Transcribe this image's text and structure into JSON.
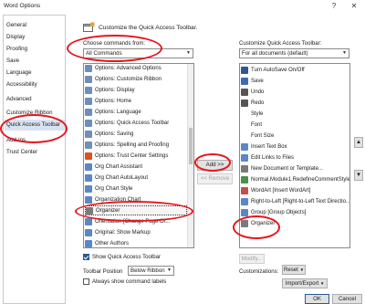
{
  "window": {
    "title": "Word Options",
    "help": "?",
    "close": "✕"
  },
  "sidebar": {
    "items": [
      {
        "label": "General"
      },
      {
        "label": "Display"
      },
      {
        "label": "Proofing"
      },
      {
        "label": "Save"
      },
      {
        "label": "Language"
      },
      {
        "label": "Accessibility"
      },
      {
        "label": "Advanced"
      },
      {
        "label": "Customize Ribbon"
      },
      {
        "label": "Quick Access Toolbar"
      },
      {
        "label": "Add-ins"
      },
      {
        "label": "Trust Center"
      }
    ],
    "active_index": 8
  },
  "header": {
    "title": "Customize the Quick Access Toolbar."
  },
  "left": {
    "choose_label": "Choose commands from:",
    "choose_value": "All Commands",
    "items": [
      {
        "label": "Options: Advanced Options",
        "icon": "options-icon",
        "color": "#6f8fb8"
      },
      {
        "label": "Options: Customize Ribbon",
        "icon": "options-icon",
        "color": "#6f8fb8"
      },
      {
        "label": "Options: Display",
        "icon": "options-icon",
        "color": "#6f8fb8"
      },
      {
        "label": "Options: Home",
        "icon": "options-icon",
        "color": "#6f8fb8"
      },
      {
        "label": "Options: Language",
        "icon": "options-icon",
        "color": "#6f8fb8"
      },
      {
        "label": "Options: Quick Access Toolbar",
        "icon": "options-icon",
        "color": "#6f8fb8"
      },
      {
        "label": "Options: Saving",
        "icon": "options-icon",
        "color": "#6f8fb8"
      },
      {
        "label": "Options: Spelling and Proofing",
        "icon": "options-icon",
        "color": "#6f8fb8"
      },
      {
        "label": "Options: Trust Center Settings",
        "icon": "shield-icon",
        "color": "#d9541e"
      },
      {
        "label": "Org Chart Assistant",
        "icon": "org-chart-icon",
        "color": "#5b87c7"
      },
      {
        "label": "Org Chart AutoLayout",
        "icon": "org-chart-icon",
        "color": "#5b87c7"
      },
      {
        "label": "Org Chart Style",
        "icon": "org-chart-icon",
        "color": "#5b87c7"
      },
      {
        "label": "Organization Chart",
        "icon": "org-chart-icon",
        "color": "#5b87c7"
      },
      {
        "label": "Organizer",
        "icon": "organizer-icon",
        "color": "#7a7a7a"
      },
      {
        "label": "Orientation [Change Page Or...",
        "icon": "orientation-icon",
        "color": "#5b87c7"
      },
      {
        "label": "Original: Show Markup",
        "icon": "markup-icon",
        "color": "#5b87c7"
      },
      {
        "label": "Other Authors",
        "icon": "authors-icon",
        "color": "#5b87c7"
      }
    ],
    "selected_index": 13
  },
  "middle": {
    "add_label": "Add >>",
    "remove_label": "<< Remove"
  },
  "right": {
    "customize_label": "Customize Quick Access Toolbar:",
    "customize_value": "For all documents (default)",
    "items": [
      {
        "label": "Turn AutoSave On/Off",
        "icon": "autosave-icon",
        "color": "#2b579a"
      },
      {
        "label": "Save",
        "icon": "save-icon",
        "color": "#3b6bb4"
      },
      {
        "label": "Undo",
        "icon": "undo-icon",
        "color": "#555555"
      },
      {
        "label": "Redo",
        "icon": "redo-icon",
        "color": "#555555"
      },
      {
        "label": "Style",
        "icon": "",
        "color": ""
      },
      {
        "label": "Font",
        "icon": "",
        "color": ""
      },
      {
        "label": "Font Size",
        "icon": "",
        "color": ""
      },
      {
        "label": "Insert Text Box",
        "icon": "text-box-icon",
        "color": "#5b87c7"
      },
      {
        "label": "Edit Links to Files",
        "icon": "links-icon",
        "color": "#5b87c7"
      },
      {
        "label": "New Document or Template...",
        "icon": "new-doc-icon",
        "color": "#7a7a7a"
      },
      {
        "label": "Normal.Module1.RedefineCommentStyle",
        "icon": "macro-icon",
        "color": "#4a8f4a"
      },
      {
        "label": "WordArt [Insert WordArt]",
        "icon": "wordart-icon",
        "color": "#c0504d"
      },
      {
        "label": "Right-to-Left [Right-to-Left Text Directio...",
        "icon": "rtl-icon",
        "color": "#5b87c7"
      },
      {
        "label": "Group [Group Objects]",
        "icon": "group-icon",
        "color": "#5b87c7"
      },
      {
        "label": "Organizer",
        "icon": "organizer-icon",
        "color": "#7a7a7a"
      }
    ],
    "modify_label": "Modify...",
    "customizations_label": "Customizations:",
    "reset_label": "Reset",
    "import_export_label": "Import/Export"
  },
  "bottom": {
    "show_qat_label": "Show Quick Access Toolbar",
    "toolbar_position_label": "Toolbar Position",
    "toolbar_position_value": "Below Ribbon",
    "always_show_labels": "Always show command labels"
  },
  "footer": {
    "ok_label": "OK",
    "cancel_label": "Cancel"
  },
  "colors": {
    "annotation": "#e5161c",
    "selection": "#d8e4f2",
    "accent": "#2b5797"
  }
}
